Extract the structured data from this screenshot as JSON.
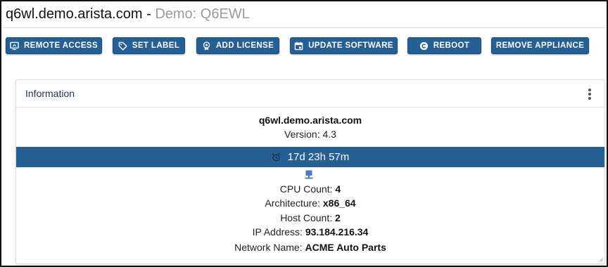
{
  "header": {
    "hostname": "q6wl.demo.arista.com",
    "separator": " - ",
    "demo_label": "Demo: Q6EWL"
  },
  "toolbar": {
    "remote_access": "REMOTE ACCESS",
    "set_label": "SET LABEL",
    "add_license": "ADD LICENSE",
    "update_software": "UPDATE SOFTWARE",
    "reboot": "REBOOT",
    "remove_appliance": "REMOVE APPLIANCE"
  },
  "card": {
    "title": "Information",
    "hostname": "q6wl.demo.arista.com",
    "version_label": "Version: ",
    "version_value": "4.3",
    "uptime": "17d 23h 57m",
    "details": [
      {
        "label": "CPU Count: ",
        "value": "4"
      },
      {
        "label": "Architecture: ",
        "value": "x86_64"
      },
      {
        "label": "Host Count: ",
        "value": "2"
      },
      {
        "label": "IP Address: ",
        "value": "93.184.216.34"
      },
      {
        "label": "Network Name: ",
        "value": "ACME Auto Parts"
      }
    ]
  },
  "icons": {
    "remote_access": "monitor-icon",
    "set_label": "tag-icon",
    "add_license": "badge-icon",
    "update_software": "calendar-icon",
    "reboot": "copyright-icon",
    "uptime": "alarm-clock-icon",
    "hardware": "computer-icon",
    "menu": "kebab-menu-icon"
  },
  "colors": {
    "primary": "#265f93",
    "title_muted": "#9a9a9a",
    "card_title": "#1d3550"
  }
}
